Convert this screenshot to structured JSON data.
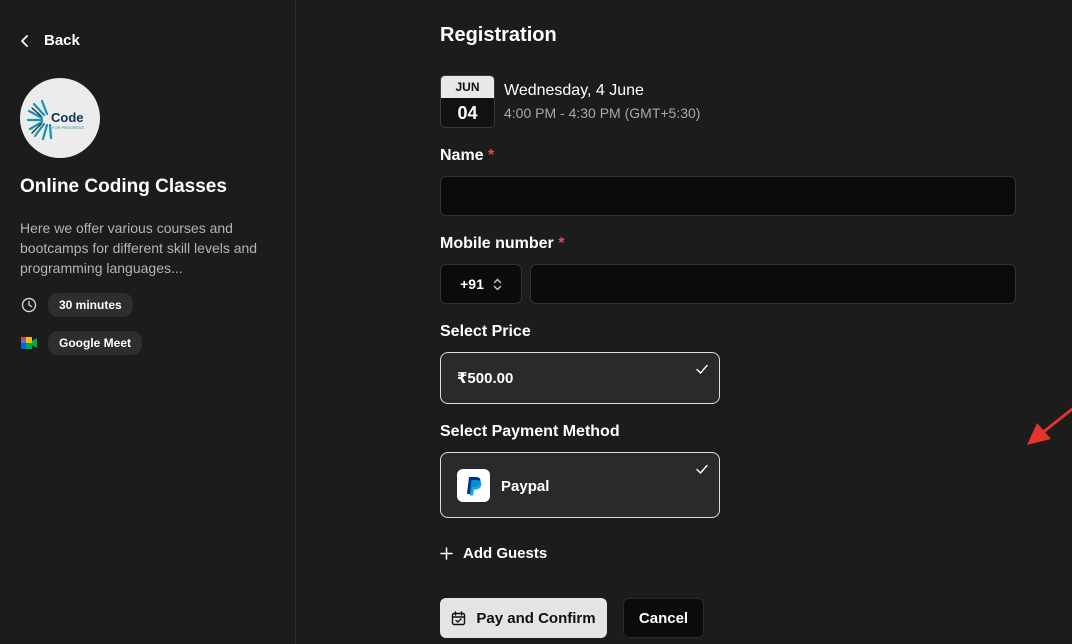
{
  "sidebar": {
    "back_label": "Back",
    "org_title": "Online Coding Classes",
    "description": "Here we offer various courses and bootcamps for different skill levels and programming languages...",
    "duration": "30 minutes",
    "location": "Google Meet",
    "logo_text": "Code",
    "logo_subtext": "FOR PROGRESS"
  },
  "main": {
    "title": "Registration",
    "date": {
      "month": "JUN",
      "day": "04",
      "full": "Wednesday, 4 June",
      "time_range": "4:00 PM - 4:30 PM (GMT+5:30)"
    },
    "name_label": "Name",
    "name_value": "",
    "mobile_label": "Mobile number",
    "country_code": "+91",
    "mobile_value": "",
    "required_mark": "*",
    "price_label": "Select Price",
    "price_option": "₹500.00",
    "payment_label": "Select Payment Method",
    "payment_option": "Paypal",
    "add_guests": "Add Guests",
    "confirm_button": "Pay and Confirm",
    "cancel_button": "Cancel"
  },
  "colors": {
    "background": "#1c1c1c",
    "required": "#e5484d",
    "annotation_arrow": "#e5342a",
    "paypal_dark": "#003087",
    "paypal_light": "#009cde"
  }
}
